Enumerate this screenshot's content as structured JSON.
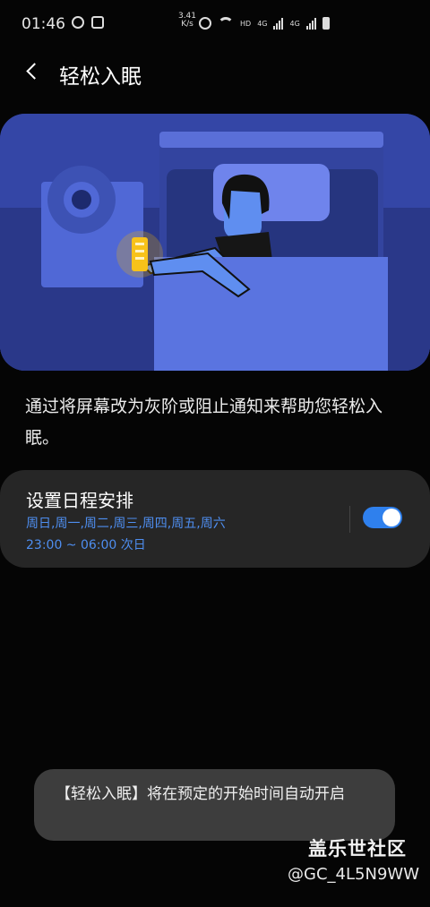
{
  "status_bar": {
    "time": "01:46",
    "net_speed_value": "3.41",
    "net_speed_unit": "K/s",
    "hd_label": "HD",
    "network_label_1": "4G",
    "network_label_2": "4G",
    "icons": [
      "notification-icon",
      "app-notification-icon",
      "alarm-icon",
      "wifi-icon",
      "signal-icon",
      "signal-icon",
      "battery-icon"
    ]
  },
  "header": {
    "title": "轻松入眠"
  },
  "description": "通过将屏幕改为灰阶或阻止通知来帮助您轻松入眠。",
  "schedule": {
    "title": "设置日程安排",
    "days": "周日,周一,周二,周三,周四,周五,周六",
    "time_range": "23:00 ~ 06:00 次日",
    "enabled": true
  },
  "toast": {
    "message": "【轻松入眠】将在预定的开始时间自动开启"
  },
  "watermark": {
    "name": "盖乐世社区",
    "id": "@GC_4L5N9WW"
  },
  "colors": {
    "accent": "#2f80ed",
    "link_text": "#4e8ef0",
    "card_bg": "#262626",
    "illustration_bg": "#2f3f9c"
  }
}
